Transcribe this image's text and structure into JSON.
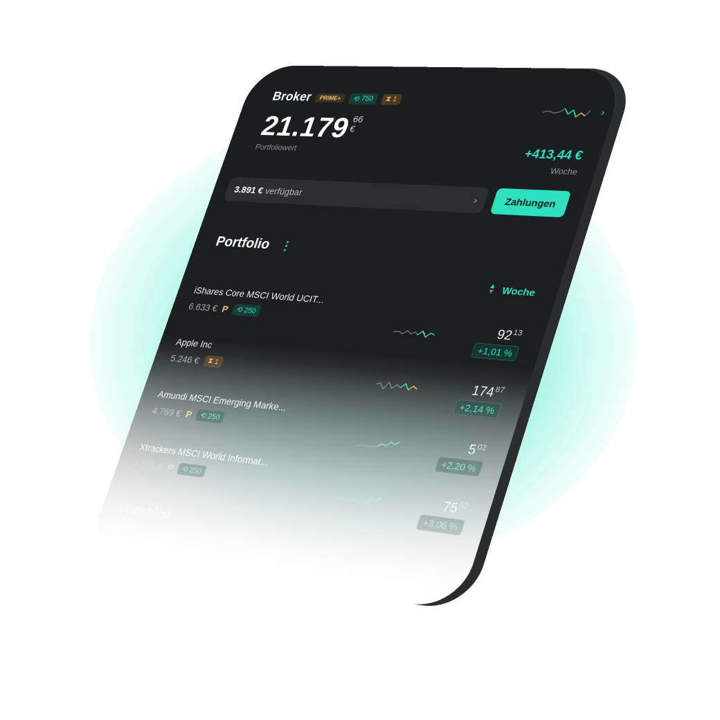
{
  "colors": {
    "accent": "#2ee0c0",
    "background": "#1b1d1f",
    "badge_gold": "#f0c36a"
  },
  "header": {
    "title": "Broker",
    "badges": {
      "prime": "PRIME+",
      "savings_plans": "750",
      "pending": "1"
    },
    "portfolio_value_main": "21.179",
    "portfolio_value_cents": "66",
    "portfolio_value_currency": "€",
    "portfolio_label": "Portfoliowert",
    "gain_amount": "+413,44 €",
    "gain_period": "Woche"
  },
  "cash": {
    "amount": "3.891 €",
    "label": "verfügbar",
    "chevron": "›",
    "button": "Zahlungen"
  },
  "portfolio": {
    "title": "Portfolio",
    "menu_icon": "⋮",
    "sort_label": "Woche",
    "items": [
      {
        "name": "iShares Core MSCI World UCIT...",
        "value": "6.633 €",
        "show_p": true,
        "badge": "250",
        "badge_icon": "⟲",
        "price_main": "92",
        "price_cents": "13",
        "pct": "+1,01 %"
      },
      {
        "name": "Apple Inc",
        "value": "5.246 €",
        "show_p": false,
        "badge": "1",
        "badge_icon": "⧗",
        "price_main": "174",
        "price_cents": "87",
        "pct": "+2,14 %"
      },
      {
        "name": "Amundi MSCI Emerging Marke...",
        "value": "4.769 €",
        "show_p": true,
        "badge": "250",
        "badge_icon": "⟲",
        "price_main": "5",
        "price_cents": "02",
        "pct": "+2,20 %"
      },
      {
        "name": "Xtrackers MSCI World Informat...",
        "value": "4.531 €",
        "show_p": true,
        "badge": "250",
        "badge_icon": "⟲",
        "price_main": "75",
        "price_cents": "52",
        "pct": "+3,06 %"
      }
    ]
  },
  "watchlist": {
    "title": "Watchlist"
  }
}
